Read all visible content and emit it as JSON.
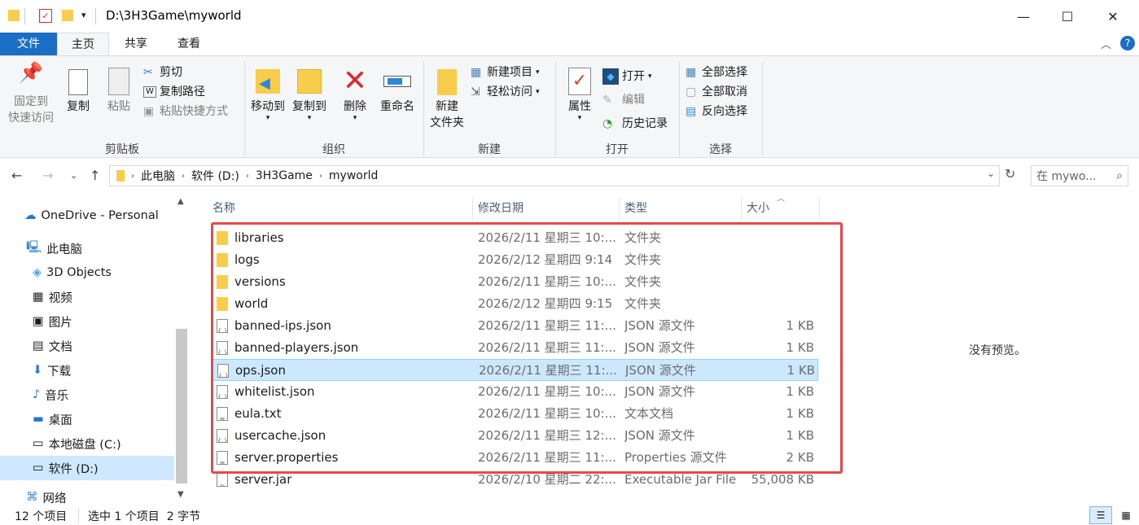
{
  "window": {
    "title": "D:\\3H3Game\\myworld"
  },
  "tabs": {
    "file": "文件",
    "home": "主页",
    "share": "共享",
    "view": "查看"
  },
  "ribbon": {
    "clipboard": {
      "pin": "固定到\n快速访问",
      "copy": "复制",
      "paste": "粘贴",
      "cut": "剪切",
      "copy_path": "复制路径",
      "paste_shortcut": "粘贴快捷方式",
      "label": "剪贴板"
    },
    "organize": {
      "move": "移动到",
      "copyto": "复制到",
      "delete": "删除",
      "rename": "重命名",
      "label": "组织"
    },
    "new": {
      "new_folder": "新建\n文件夹",
      "new_item": "新建项目",
      "easy_access": "轻松访问",
      "label": "新建"
    },
    "open": {
      "properties": "属性",
      "open": "打开",
      "edit": "编辑",
      "history": "历史记录",
      "label": "打开"
    },
    "select": {
      "all": "全部选择",
      "none": "全部取消",
      "invert": "反向选择",
      "label": "选择"
    }
  },
  "address": {
    "parts": [
      "此电脑",
      "软件 (D:)",
      "3H3Game",
      "myworld"
    ],
    "search_placeholder": "在 mywo..."
  },
  "sidebar": {
    "items": [
      "OneDrive - Personal",
      "此电脑",
      "3D Objects",
      "视频",
      "图片",
      "文档",
      "下载",
      "音乐",
      "桌面",
      "本地磁盘 (C:)",
      "软件 (D:)",
      "网络"
    ]
  },
  "columns": {
    "name": "名称",
    "date": "修改日期",
    "type": "类型",
    "size": "大小"
  },
  "files": [
    {
      "name": "libraries",
      "date": "2026/2/11 星期三 10:...",
      "type": "文件夹",
      "size": "",
      "kind": "folder"
    },
    {
      "name": "logs",
      "date": "2026/2/12 星期四 9:14",
      "type": "文件夹",
      "size": "",
      "kind": "folder"
    },
    {
      "name": "versions",
      "date": "2026/2/11 星期三 10:...",
      "type": "文件夹",
      "size": "",
      "kind": "folder"
    },
    {
      "name": "world",
      "date": "2026/2/12 星期四 9:15",
      "type": "文件夹",
      "size": "",
      "kind": "folder"
    },
    {
      "name": "banned-ips.json",
      "date": "2026/2/11 星期三 11:...",
      "type": "JSON 源文件",
      "size": "1 KB",
      "kind": "json"
    },
    {
      "name": "banned-players.json",
      "date": "2026/2/11 星期三 11:...",
      "type": "JSON 源文件",
      "size": "1 KB",
      "kind": "json"
    },
    {
      "name": "ops.json",
      "date": "2026/2/11 星期三 11:...",
      "type": "JSON 源文件",
      "size": "1 KB",
      "kind": "json"
    },
    {
      "name": "whitelist.json",
      "date": "2026/2/11 星期三 10:...",
      "type": "JSON 源文件",
      "size": "1 KB",
      "kind": "json"
    },
    {
      "name": "eula.txt",
      "date": "2026/2/11 星期三 10:...",
      "type": "文本文档",
      "size": "1 KB",
      "kind": "txt"
    },
    {
      "name": "usercache.json",
      "date": "2026/2/11 星期三 12:...",
      "type": "JSON 源文件",
      "size": "1 KB",
      "kind": "json"
    },
    {
      "name": "server.properties",
      "date": "2026/2/11 星期三 11:...",
      "type": "Properties 源文件",
      "size": "2 KB",
      "kind": "txt"
    },
    {
      "name": "server.jar",
      "date": "2026/2/10 星期二 22:...",
      "type": "Executable Jar File",
      "size": "55,008 KB",
      "kind": "jar"
    }
  ],
  "preview": "没有预览。",
  "status": {
    "count": "12 个项目",
    "selected": "选中 1 个项目  2 字节"
  }
}
